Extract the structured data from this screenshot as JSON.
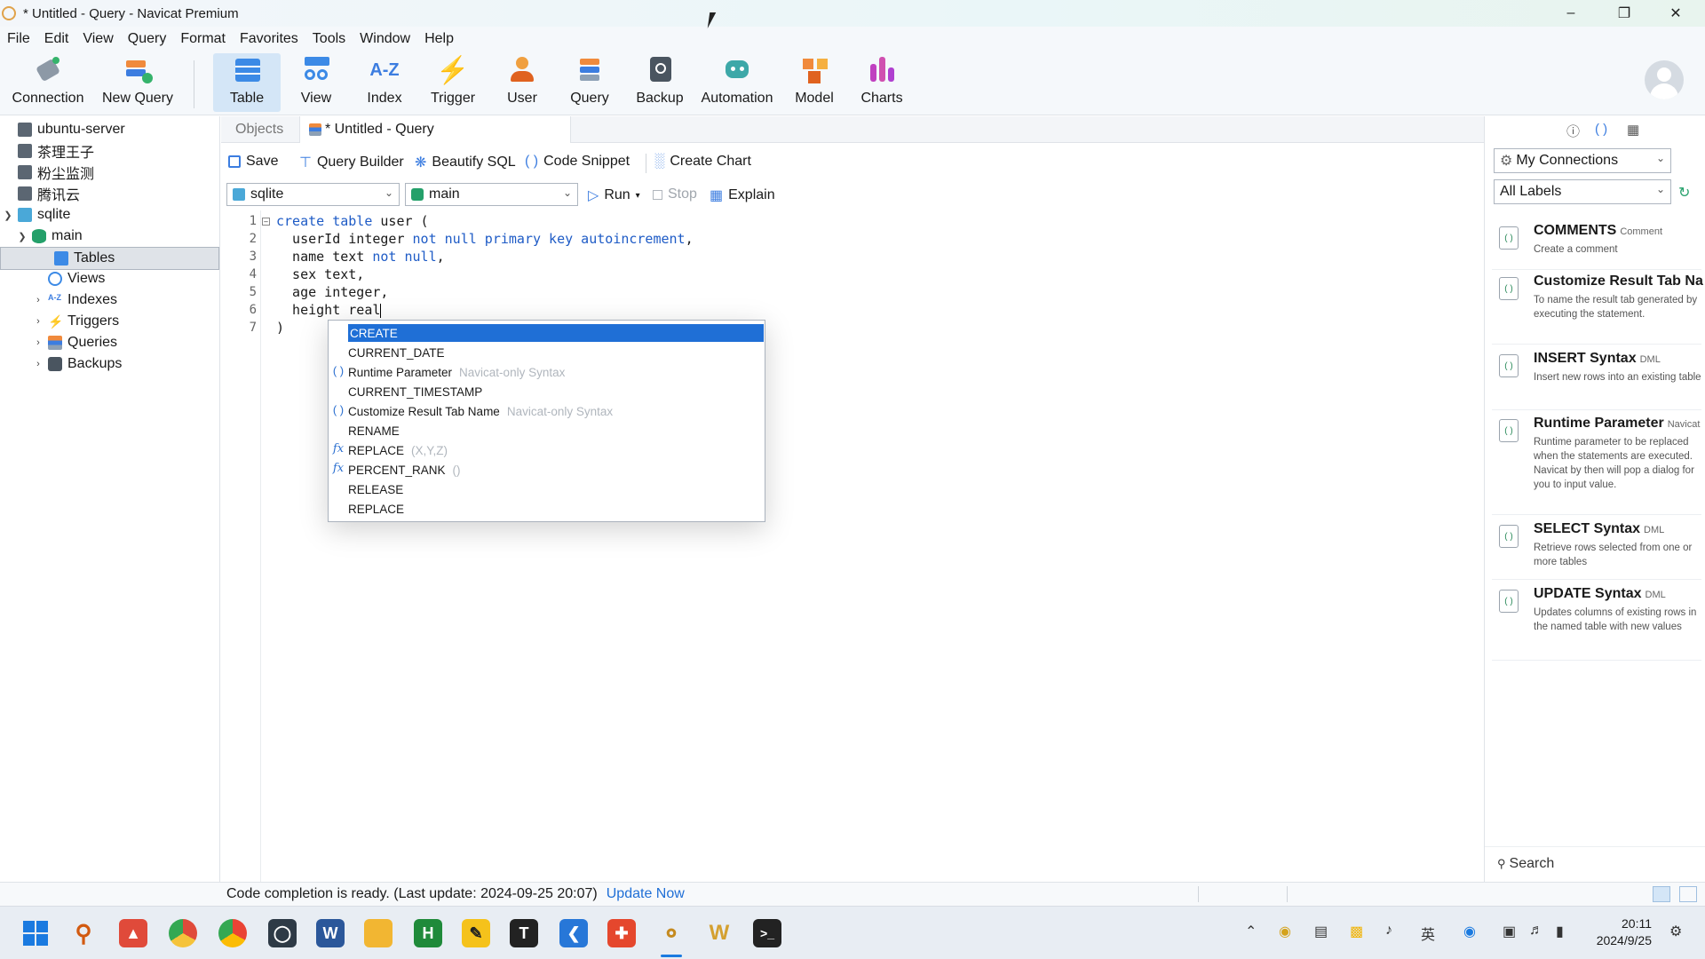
{
  "window": {
    "title": "* Untitled - Query - Navicat Premium"
  },
  "menu": [
    "File",
    "Edit",
    "View",
    "Query",
    "Format",
    "Favorites",
    "Tools",
    "Window",
    "Help"
  ],
  "toolbar": {
    "connection": "Connection",
    "new_query": "New Query",
    "table": "Table",
    "view": "View",
    "index": "Index",
    "trigger": "Trigger",
    "user": "User",
    "query": "Query",
    "backup": "Backup",
    "automation": "Automation",
    "model": "Model",
    "charts": "Charts"
  },
  "tree": {
    "items": [
      "ubuntu-server",
      "茶理王子",
      "粉尘监测",
      "腾讯云",
      "sqlite",
      "main",
      "Tables",
      "Views",
      "Indexes",
      "Triggers",
      "Queries",
      "Backups"
    ]
  },
  "tabs": {
    "objects": "Objects",
    "query": "* Untitled - Query"
  },
  "query_tools": {
    "save": "Save",
    "query_builder": "Query Builder",
    "beautify": "Beautify SQL",
    "snippet": "Code Snippet",
    "chart": "Create Chart"
  },
  "selectors": {
    "connection": "sqlite",
    "database": "main",
    "run": "Run",
    "stop": "Stop",
    "explain": "Explain"
  },
  "editor": {
    "line_numbers": [
      "1",
      "2",
      "3",
      "4",
      "5",
      "6",
      "7"
    ],
    "l1_a": "create table ",
    "l1_b": "user (",
    "l2_a": "  userId integer ",
    "l2_b": "not null primary key autoincrement",
    "l2_c": ",",
    "l3_a": "  name text ",
    "l3_b": "not null",
    "l3_c": ",",
    "l4": "  sex text,",
    "l5": "  age integer,",
    "l6": "  height real",
    "l7": ")"
  },
  "autocomplete": {
    "items": [
      {
        "label": "CREATE",
        "hint": ""
      },
      {
        "label": "CURRENT_DATE",
        "hint": ""
      },
      {
        "label": "Runtime Parameter",
        "hint": "Navicat-only Syntax"
      },
      {
        "label": "CURRENT_TIMESTAMP",
        "hint": ""
      },
      {
        "label": "Customize Result Tab Name",
        "hint": "Navicat-only Syntax"
      },
      {
        "label": "RENAME",
        "hint": ""
      },
      {
        "label": "REPLACE",
        "hint": "(X,Y,Z)"
      },
      {
        "label": "PERCENT_RANK",
        "hint": "()"
      },
      {
        "label": "RELEASE",
        "hint": ""
      },
      {
        "label": "REPLACE",
        "hint": ""
      }
    ]
  },
  "right_panel": {
    "connections": "My Connections",
    "labels": "All Labels",
    "snippets": [
      {
        "title": "COMMENTS",
        "tag": "Comment",
        "desc": "Create a comment"
      },
      {
        "title": "Customize Result Tab Na",
        "tag": "",
        "desc": "To name the result tab generated by executing the statement."
      },
      {
        "title": "INSERT Syntax",
        "tag": "DML",
        "desc": "Insert new rows into an existing table"
      },
      {
        "title": "Runtime Parameter",
        "tag": "Navicat",
        "desc": "Runtime parameter to be replaced when the statements are executed. Navicat by then will pop a dialog for you to input value."
      },
      {
        "title": "SELECT Syntax",
        "tag": "DML",
        "desc": "Retrieve rows selected from one or more tables"
      },
      {
        "title": "UPDATE Syntax",
        "tag": "DML",
        "desc": "Updates columns of existing rows in the named table with new values"
      }
    ],
    "search": "Search"
  },
  "status": {
    "message": "Code completion is ready. (Last update: 2024-09-25 20:07)",
    "update_now": "Update Now"
  },
  "taskbar": {
    "ime": "英",
    "time": "20:11",
    "date": "2024/9/25"
  },
  "colors": {
    "accent": "#1f6fd6",
    "selection": "#d4e6f7",
    "keyword": "#1e5bc6"
  }
}
